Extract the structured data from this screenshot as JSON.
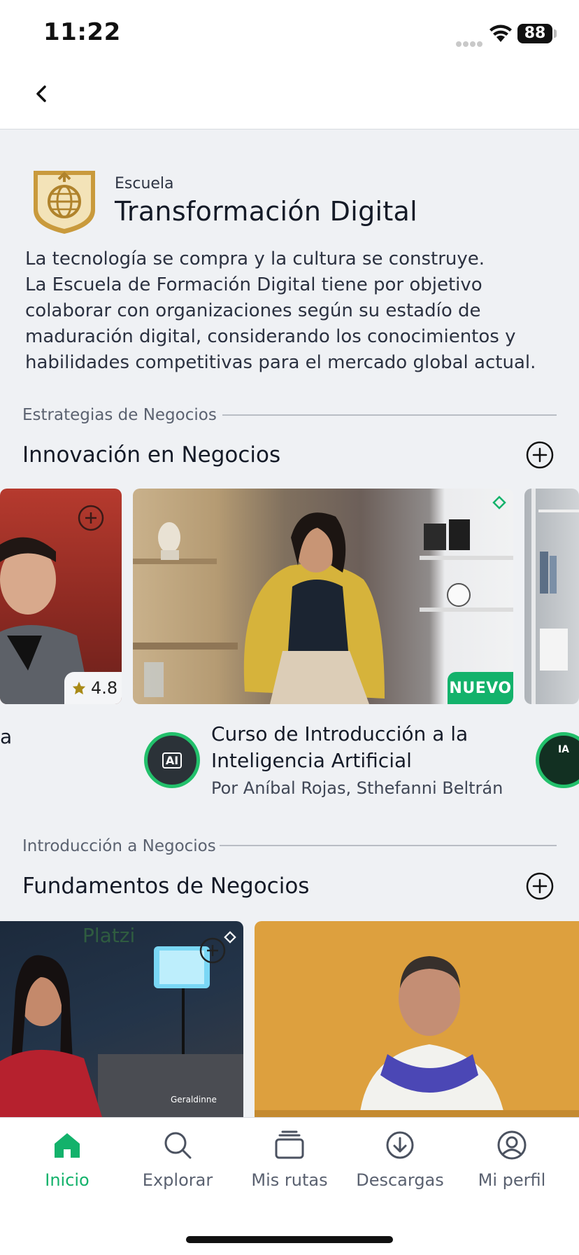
{
  "status_bar": {
    "time": "11:22",
    "battery": "88"
  },
  "school": {
    "kicker": "Escuela",
    "title": "Transformación Digital",
    "description": "La tecnología se compra y la cultura se construye.\nLa Escuela de Formación Digital tiene por objetivo colaborar con organizaciones según su estadío de maduración digital, considerando los conocimientos y habilidades competitivas para el mercado global actual."
  },
  "sections": [
    {
      "kicker": "Estrategias de Negocios",
      "title": "Innovación en Negocios",
      "cards": [
        {
          "rating": "4.8"
        },
        {
          "badge": "NUEVO",
          "title": "Curso de Introducción a la Inteligencia Artificial",
          "by": "Por Aníbal Rojas, Sthefanni Beltrán",
          "icon_text": "AI"
        },
        {
          "icon_text": "IA"
        }
      ]
    },
    {
      "kicker": "Introducción a Negocios",
      "title": "Fundamentos de Negocios",
      "cards": [
        {
          "watermark": "Platzi",
          "credit": "Geraldinne"
        },
        {}
      ]
    }
  ],
  "bottom_nav": [
    {
      "label": "Inicio",
      "icon": "home-icon",
      "active": true
    },
    {
      "label": "Explorar",
      "icon": "search-icon"
    },
    {
      "label": "Mis rutas",
      "icon": "stack-icon"
    },
    {
      "label": "Descargas",
      "icon": "download-icon"
    },
    {
      "label": "Mi perfil",
      "icon": "profile-icon"
    }
  ],
  "colors": {
    "accent": "#13b26b",
    "background": "#eff1f4",
    "logo_gold": "#c99a3c"
  }
}
